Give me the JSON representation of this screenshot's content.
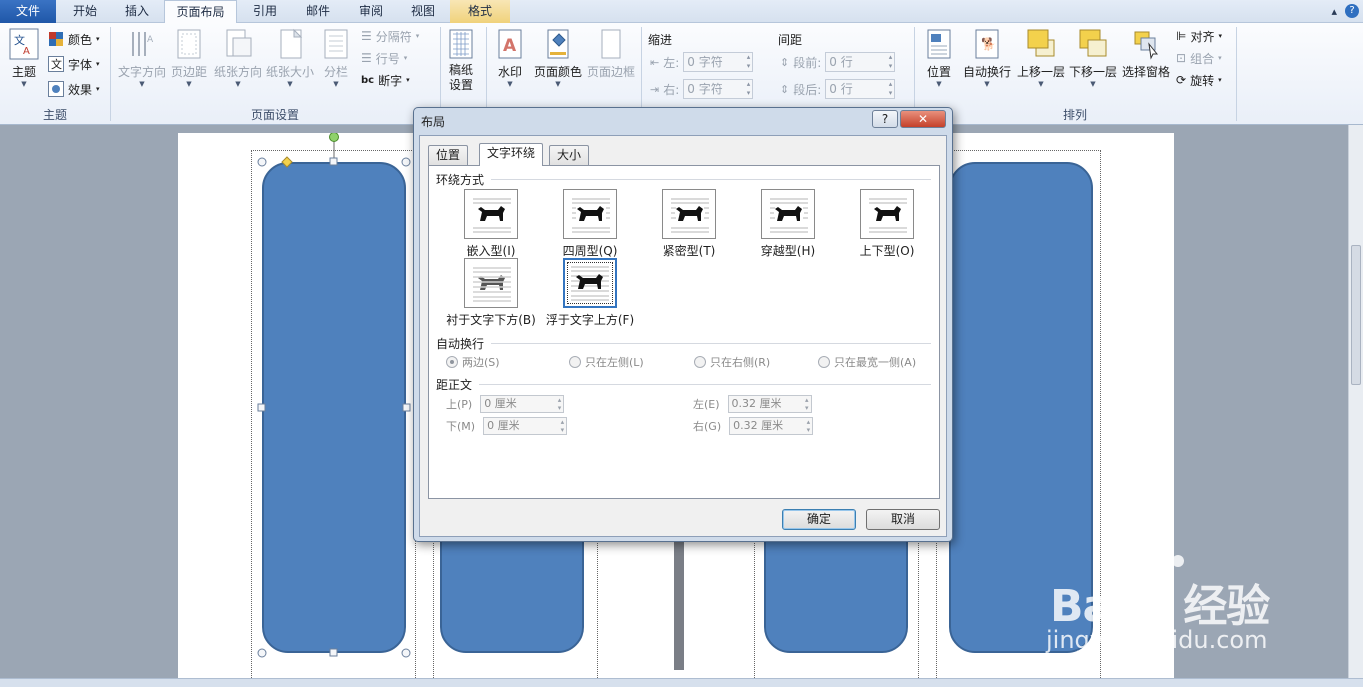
{
  "tabs": [
    {
      "label": "文件",
      "kind": "file"
    },
    {
      "label": "开始",
      "kind": "normal"
    },
    {
      "label": "插入",
      "kind": "normal"
    },
    {
      "label": "页面布局",
      "kind": "active"
    },
    {
      "label": "引用",
      "kind": "normal"
    },
    {
      "label": "邮件",
      "kind": "normal"
    },
    {
      "label": "审阅",
      "kind": "normal"
    },
    {
      "label": "视图",
      "kind": "normal"
    },
    {
      "label": "格式",
      "kind": "ctx"
    }
  ],
  "ribbon": {
    "theme_group": {
      "main": "主题",
      "colors": "颜色",
      "fonts": "字体",
      "effects": "效果",
      "label": "主题"
    },
    "page_setup": {
      "text_dir": "文字方向",
      "margins": "页边距",
      "orientation": "纸张方向",
      "size": "纸张大小",
      "columns": "分栏",
      "breaks": "分隔符",
      "line_numbers": "行号",
      "hyphenation": "断字",
      "label": "页面设置"
    },
    "draft": {
      "label1": "稿纸",
      "label2": "设置"
    },
    "page_bg": {
      "watermark": "水印",
      "page_color": "页面颜色",
      "page_border": "页面边框"
    },
    "paragraph": {
      "indent_title": "缩进",
      "indent_left": "左:",
      "indent_right": "右:",
      "indent_left_val": "0 字符",
      "indent_right_val": "0 字符",
      "spacing_title": "间距",
      "spacing_before": "段前:",
      "spacing_after": "段后:",
      "spacing_before_val": "0 行",
      "spacing_after_val": "0 行"
    },
    "arrange": {
      "position": "位置",
      "wrap": "自动换行",
      "forward": "上移一层",
      "backward": "下移一层",
      "selection": "选择窗格",
      "align": "对齐",
      "group": "组合",
      "rotate": "旋转",
      "label": "排列"
    }
  },
  "dialog": {
    "title": "布局",
    "help": "?",
    "close": "✕",
    "tabs": [
      "位置",
      "文字环绕",
      "大小"
    ],
    "wrap_section": "环绕方式",
    "wrap_options": [
      {
        "label": "嵌入型(I)",
        "selected": false
      },
      {
        "label": "四周型(Q)",
        "selected": false
      },
      {
        "label": "紧密型(T)",
        "selected": false
      },
      {
        "label": "穿越型(H)",
        "selected": false
      },
      {
        "label": "上下型(O)",
        "selected": false
      },
      {
        "label": "衬于文字下方(B)",
        "selected": false
      },
      {
        "label": "浮于文字上方(F)",
        "selected": true
      }
    ],
    "auto_wrap_section": "自动换行",
    "auto_wrap_options": [
      {
        "label": "两边(S)",
        "checked": true
      },
      {
        "label": "只在左侧(L)",
        "checked": false
      },
      {
        "label": "只在右侧(R)",
        "checked": false
      },
      {
        "label": "只在最宽一侧(A)",
        "checked": false
      }
    ],
    "distance_section": "距正文",
    "distance": {
      "top_label": "上(P)",
      "top_val": "0 厘米",
      "bottom_label": "下(M)",
      "bottom_val": "0 厘米",
      "left_label": "左(E)",
      "left_val": "0.32 厘米",
      "right_label": "右(G)",
      "right_val": "0.32 厘米"
    },
    "ok": "确定",
    "cancel": "取消"
  },
  "shape_color": "#4f81bd",
  "watermark": {
    "brand": "Bai",
    "brand_cn": "经验",
    "url": "jingyan.baidu.com"
  }
}
